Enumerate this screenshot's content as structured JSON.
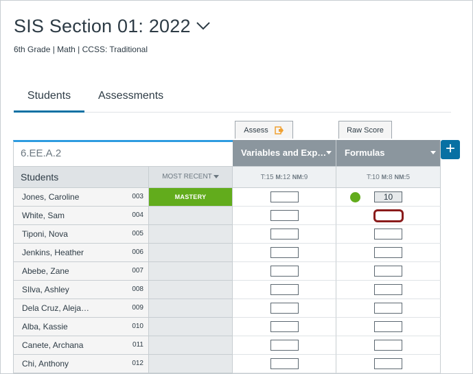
{
  "course": {
    "title": "SIS Section 01: 2022",
    "subtitle": "6th Grade  |  Math  |  CCSS: Traditional"
  },
  "tabs": [
    {
      "label": "Students",
      "active": true
    },
    {
      "label": "Assessments",
      "active": false
    }
  ],
  "toolbar": {
    "assess_label": "Assess",
    "raw_score_label": "Raw Score",
    "add_label": "+"
  },
  "grid": {
    "standard_code": "6.EE.A.2",
    "students_header": "Students",
    "most_recent_header": "MOST RECENT",
    "assessments": [
      {
        "title": "Variables and Expressions",
        "display": "Variables and Exp…",
        "counts": {
          "t": "15",
          "m": "12",
          "nm": "9"
        }
      },
      {
        "title": "Formulas",
        "display": "Formulas",
        "counts": {
          "t": "10",
          "m": "8",
          "nm": "5"
        }
      }
    ],
    "count_labels": {
      "t": "T:",
      "m": "M:",
      "nm": "NM:"
    },
    "rows": [
      {
        "name": "Jones, Caroline",
        "id": "003",
        "most_recent": "MASTERY",
        "score1": "",
        "score2": "10",
        "has_dot": true
      },
      {
        "name": "White, Sam",
        "id": "004",
        "most_recent": "",
        "score1": "",
        "score2": "",
        "focused": true
      },
      {
        "name": "Tiponi, Nova",
        "id": "005",
        "most_recent": "",
        "score1": "",
        "score2": ""
      },
      {
        "name": "Jenkins, Heather",
        "id": "006",
        "most_recent": "",
        "score1": "",
        "score2": ""
      },
      {
        "name": "Abebe, Zane",
        "id": "007",
        "most_recent": "",
        "score1": "",
        "score2": ""
      },
      {
        "name": "SIlva, Ashley",
        "id": "008",
        "most_recent": "",
        "score1": "",
        "score2": ""
      },
      {
        "name": "Dela Cruz, Aleja…",
        "id": "009",
        "most_recent": "",
        "score1": "",
        "score2": ""
      },
      {
        "name": "Alba, Kassie",
        "id": "010",
        "most_recent": "",
        "score1": "",
        "score2": ""
      },
      {
        "name": "Canete, Archana",
        "id": "011",
        "most_recent": "",
        "score1": "",
        "score2": ""
      },
      {
        "name": "Chi, Anthony",
        "id": "012",
        "most_recent": "",
        "score1": "",
        "score2": ""
      }
    ]
  },
  "colors": {
    "accent": "#0770a3",
    "mastery": "#62ac1c",
    "focus": "#8a1b1b",
    "header_gray": "#8b969e"
  }
}
